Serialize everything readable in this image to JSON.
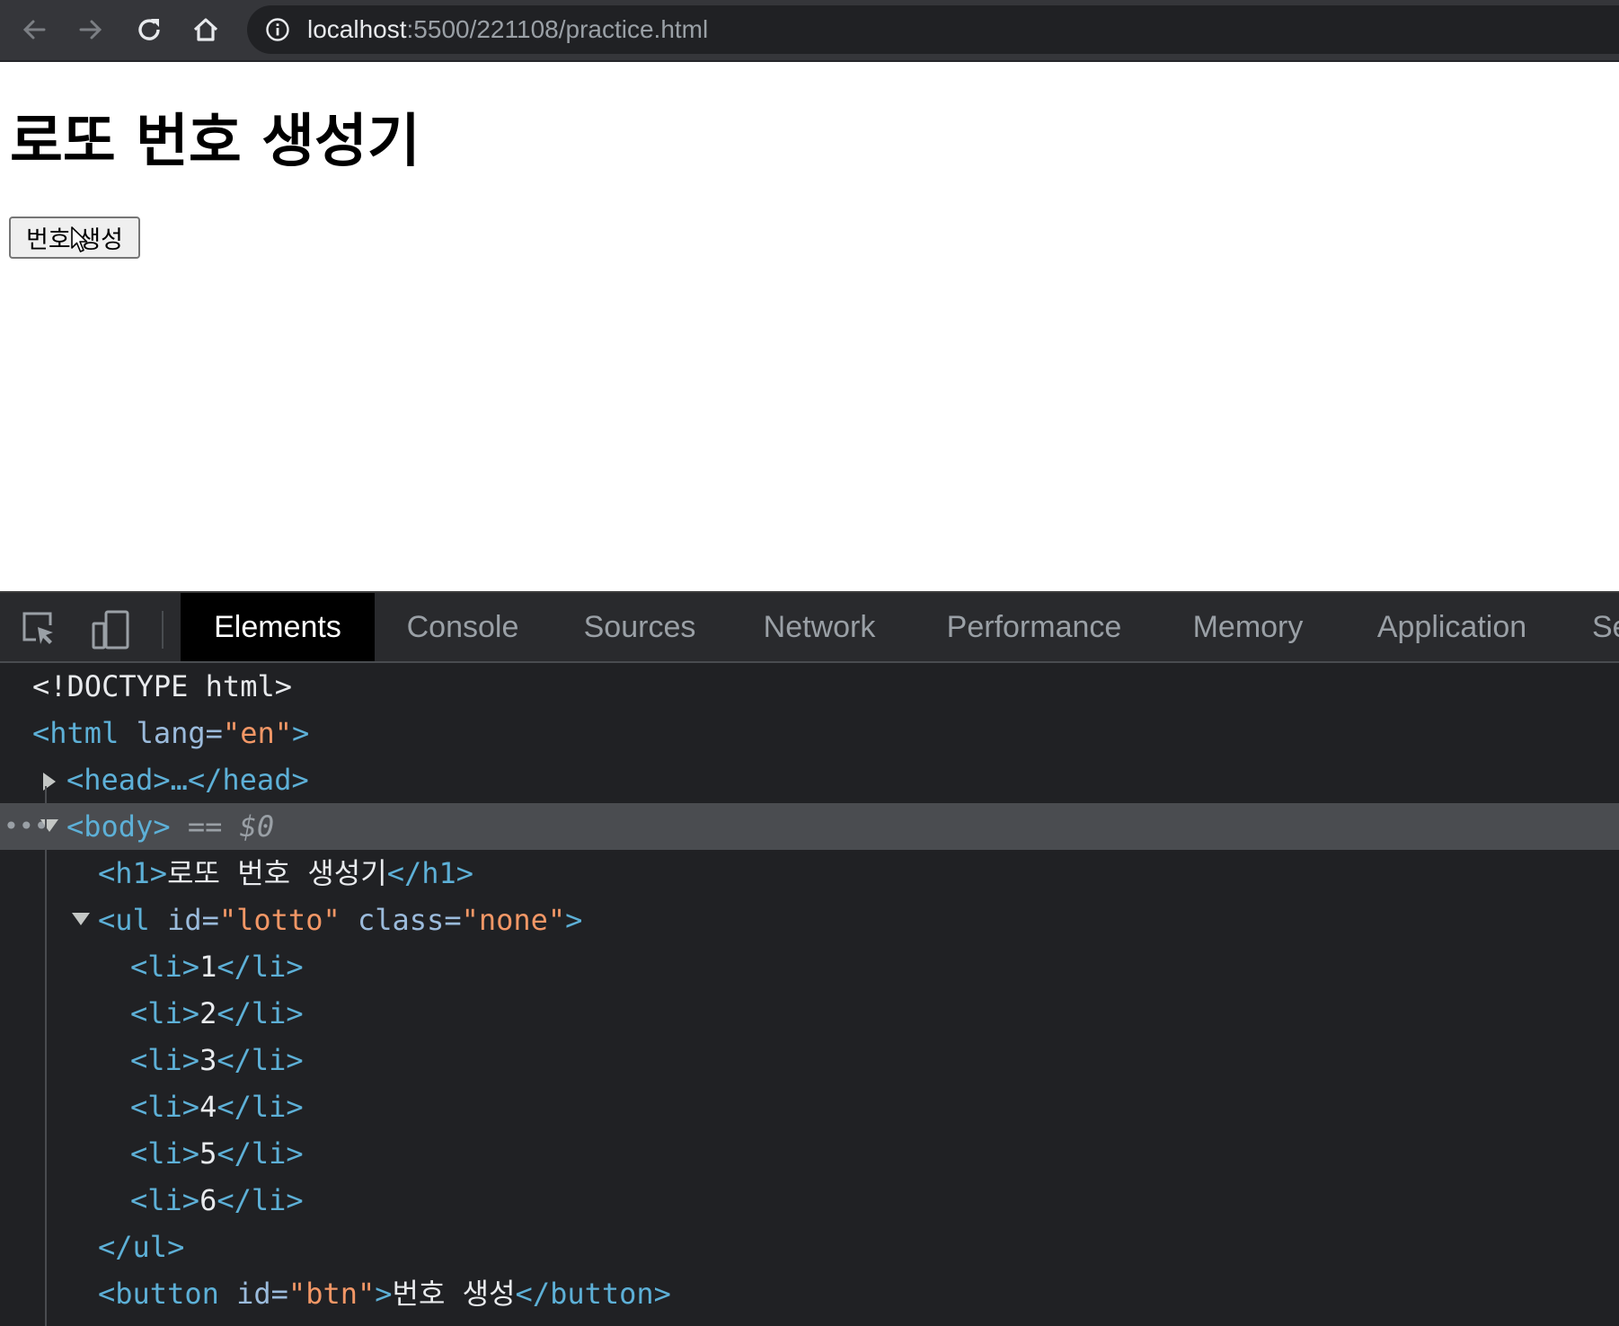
{
  "browser": {
    "url_host": "localhost",
    "url_path": ":5500/221108/practice.html",
    "nav_icons": [
      "back-arrow-icon",
      "forward-arrow-icon",
      "reload-icon",
      "home-icon"
    ]
  },
  "page": {
    "heading": "로또 번호 생성기",
    "button_label": "번호 생성"
  },
  "devtools": {
    "tabs": [
      "Elements",
      "Console",
      "Sources",
      "Network",
      "Performance",
      "Memory",
      "Application",
      "Se"
    ],
    "active_tab": "Elements",
    "dom": {
      "doctype": "<!DOCTYPE html>",
      "html_tag": "<html",
      "html_attr": "lang=",
      "html_val": "\"en\"",
      "head": "<head>…</head>",
      "body_tag": "<body>",
      "body_ref": "== $0",
      "h1_open": "<h1>",
      "h1_text": "로또 번호 생성기",
      "h1_close": "</h1>",
      "ul_open": "<ul",
      "ul_id_attr": "id=",
      "ul_id_val": "\"lotto\"",
      "ul_class_attr": "class=",
      "ul_class_val": "\"none\"",
      "ul_end": ">",
      "li_items": [
        "1",
        "2",
        "3",
        "4",
        "5",
        "6"
      ],
      "ul_close": "</ul>",
      "button_open": "<button",
      "button_attr": "id=",
      "button_val": "\"btn\"",
      "button_text": "번호 생성",
      "button_close": "</button>"
    }
  }
}
